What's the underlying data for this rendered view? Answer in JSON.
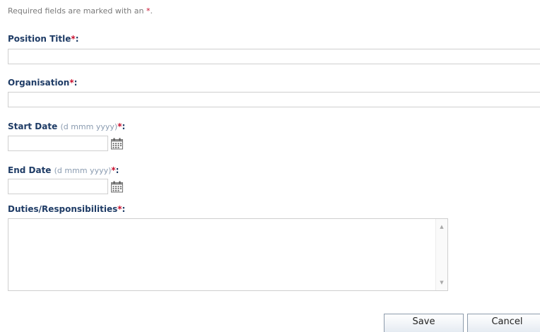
{
  "form": {
    "required_note": "Required fields are marked with an",
    "required_marker": "*",
    "note_end": ".",
    "label_suffix": ":",
    "position_title": {
      "label": "Position Title",
      "value": ""
    },
    "organisation": {
      "label": "Organisation",
      "value": ""
    },
    "start_date": {
      "label": "Start Date",
      "hint": "(d mmm yyyy)",
      "value": ""
    },
    "end_date": {
      "label": "End Date",
      "hint": "(d mmm yyyy)",
      "value": ""
    },
    "duties": {
      "label": "Duties/Responsibilities",
      "value": ""
    },
    "save_label": "Save",
    "cancel_label": "Cancel"
  },
  "icons": {
    "calendar": "calendar-icon",
    "scroll_up": "scroll-up-arrow",
    "scroll_down": "scroll-down-arrow"
  },
  "colors": {
    "label": "#1f3c66",
    "required": "#c8102e",
    "hint": "#8a9bb0",
    "note": "#7a7a7a"
  }
}
